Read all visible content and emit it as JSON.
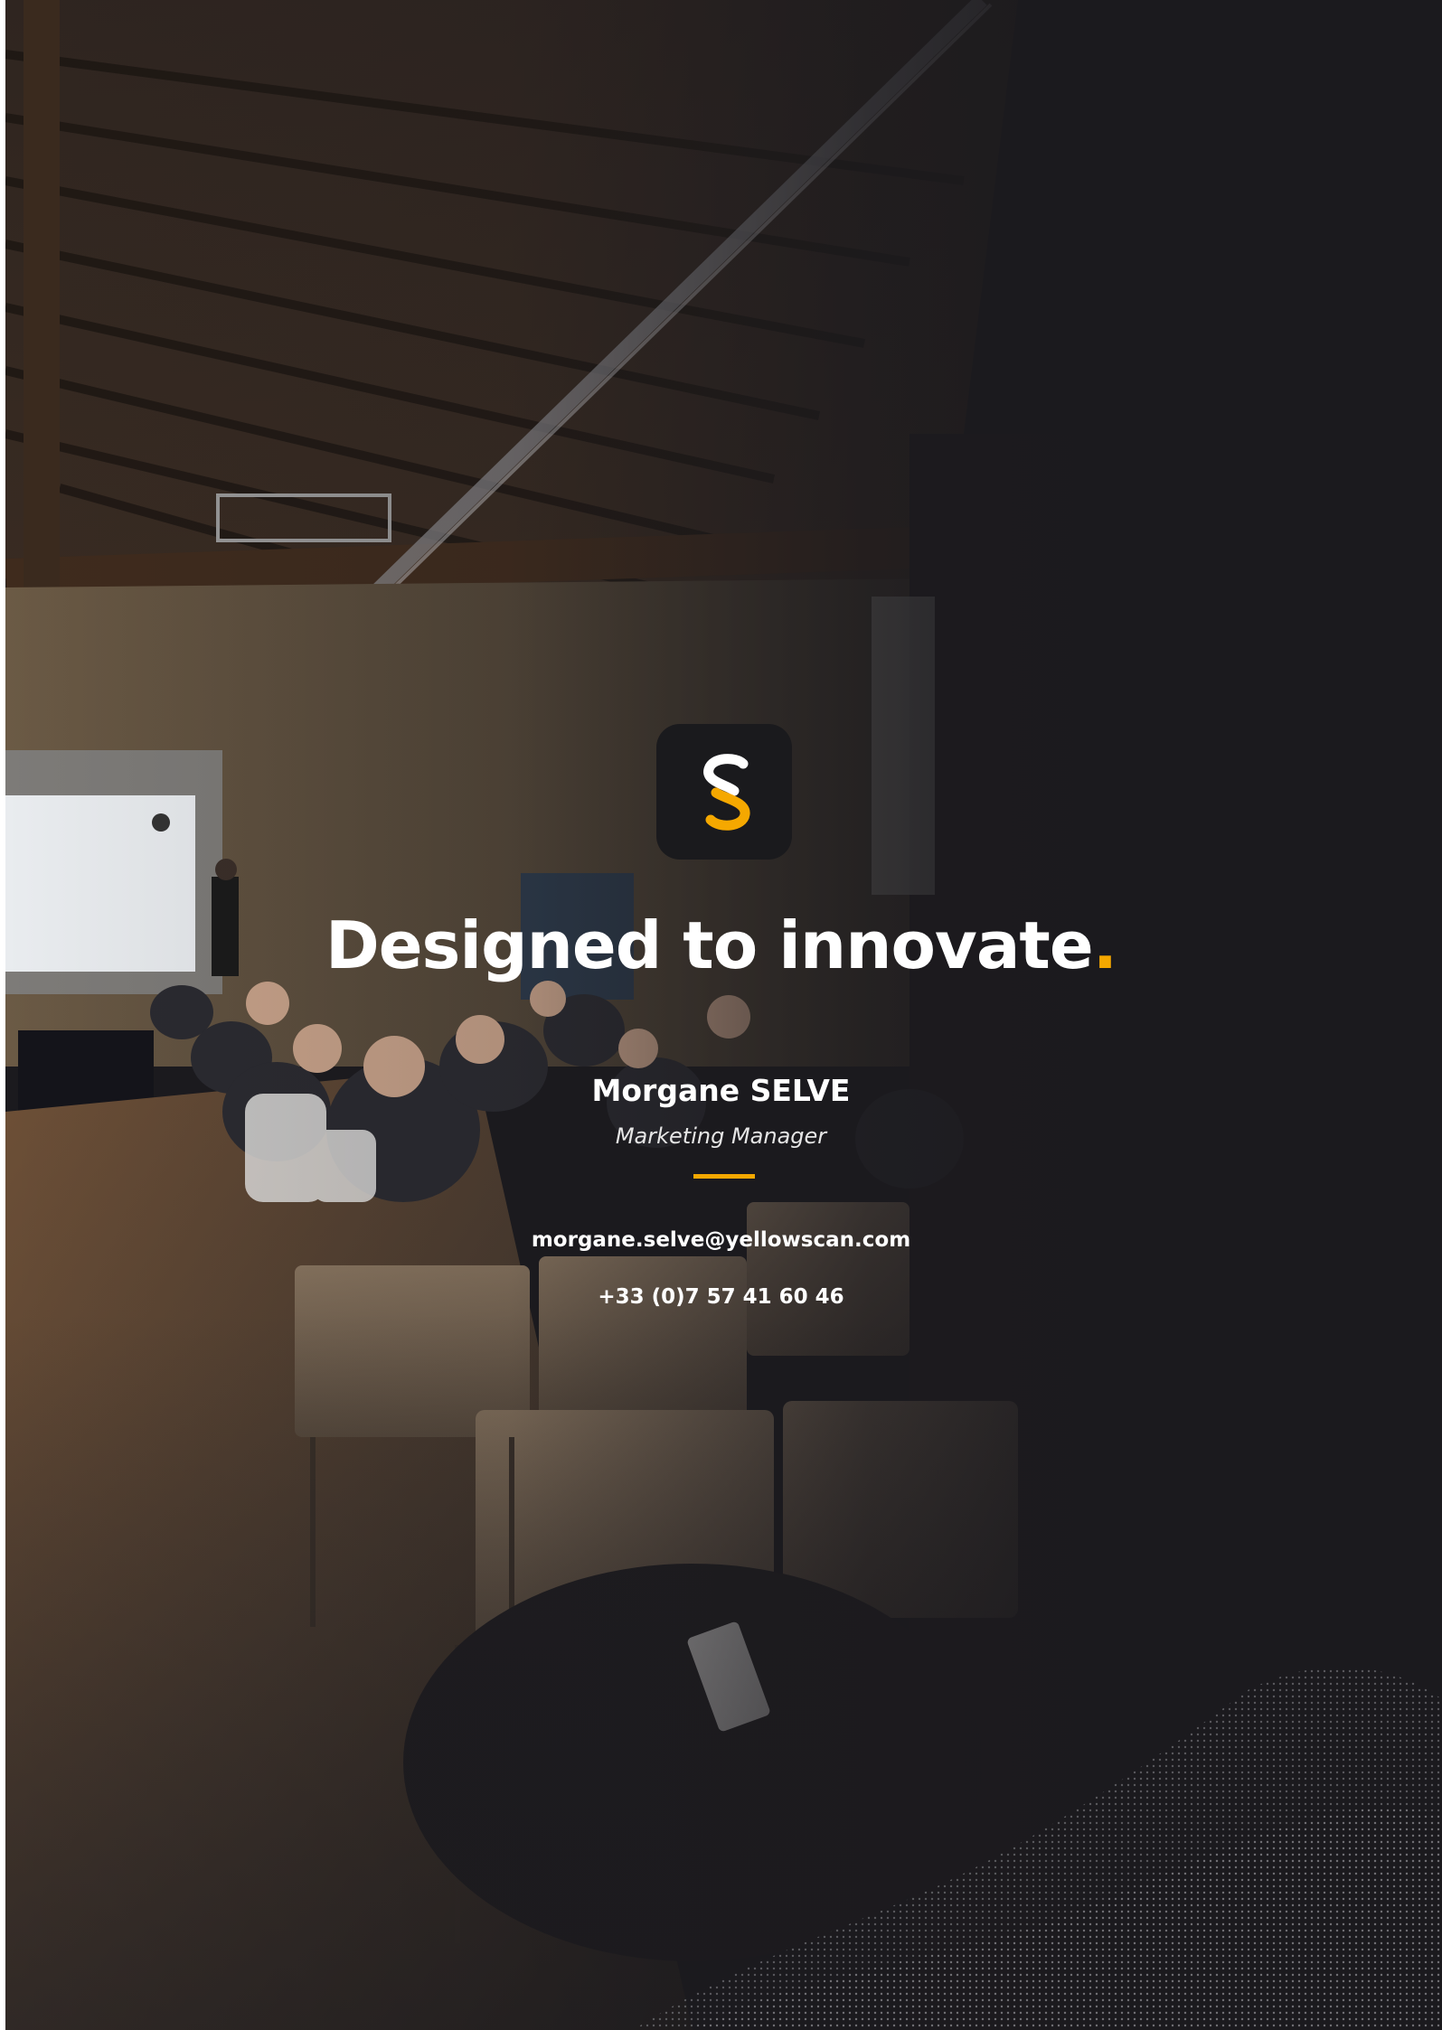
{
  "colors": {
    "background": "#1b1a1e",
    "accent": "#f5a800",
    "text": "#ffffff"
  },
  "logo": {
    "icon": "yellowscan-s-logo-icon"
  },
  "hero_image": {
    "icon": "conference-room-photo"
  },
  "headline": {
    "text": "Designed to innovate",
    "dot": "."
  },
  "contact": {
    "name": "Morgane SELVE",
    "role": "Marketing Manager",
    "email": "morgane.selve@yellowscan.com",
    "phone": "+33 (0)7 57 41 60 46"
  }
}
